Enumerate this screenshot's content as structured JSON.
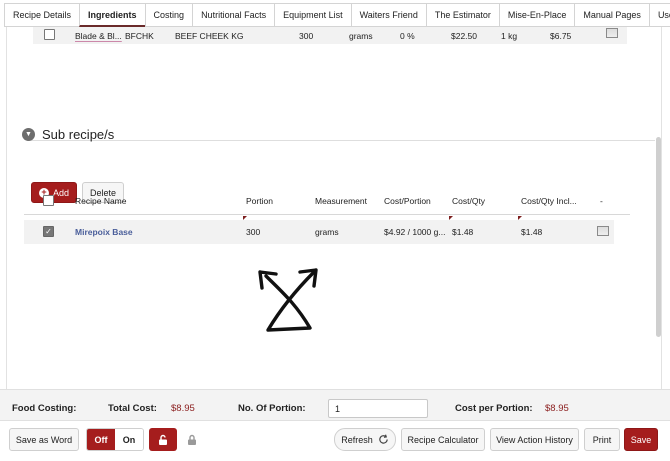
{
  "tabs": [
    {
      "label": "Recipe Details",
      "active": false
    },
    {
      "label": "Ingredients",
      "active": true
    },
    {
      "label": "Costing",
      "active": false
    },
    {
      "label": "Nutritional Facts",
      "active": false
    },
    {
      "label": "Equipment List",
      "active": false
    },
    {
      "label": "Waiters Friend",
      "active": false
    },
    {
      "label": "The Estimator",
      "active": false
    },
    {
      "label": "Mise-En-Place",
      "active": false
    },
    {
      "label": "Manual Pages",
      "active": false
    },
    {
      "label": "Used In",
      "active": false
    }
  ],
  "ingredient_row": {
    "name": "Blade & Bl...",
    "code": "BFCHK",
    "description": "BEEF CHEEK KG",
    "qty": "300",
    "unit": "grams",
    "percent": "0 %",
    "price": "$22.50",
    "pack": "1 kg",
    "cost": "$6.75"
  },
  "sub_recipe": {
    "title": "Sub recipe/s",
    "add_label": "Add",
    "delete_label": "Delete",
    "columns": [
      "Recipe Name",
      "Portion",
      "Measurement",
      "Cost/Portion",
      "Cost/Qty",
      "Cost/Qty Incl...",
      "-"
    ],
    "rows": [
      {
        "name": "Mirepoix Base",
        "portion": "300",
        "measurement": "grams",
        "cost_portion": "$4.92 / 1000 g...",
        "cost_qty": "$1.48",
        "cost_qty_incl": "$1.48",
        "checked": true
      }
    ]
  },
  "footer": {
    "food_costing_label": "Food Costing:",
    "total_cost_label": "Total Cost:",
    "total_cost_value": "$8.95",
    "portions_label": "No. Of Portion:",
    "portions_value": "1",
    "cost_per_portion_label": "Cost per Portion:",
    "cost_per_portion_value": "$8.95"
  },
  "actions": {
    "save_as_word": "Save as Word",
    "off": "Off",
    "on": "On",
    "refresh": "Refresh",
    "recipe_calculator": "Recipe Calculator",
    "view_action_history": "View Action History",
    "print": "Print",
    "save": "Save"
  },
  "colors": {
    "accent": "#a51d1d",
    "value_text": "#8a1c1c",
    "link": "#4a5e9a"
  }
}
